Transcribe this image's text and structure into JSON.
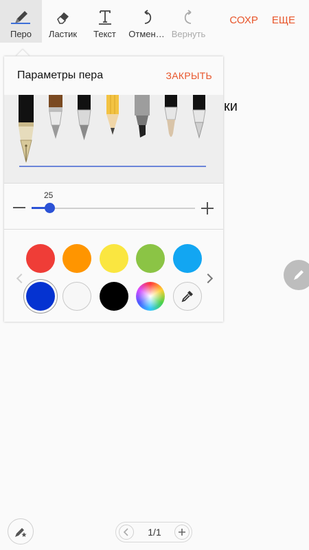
{
  "toolbar": {
    "tools": [
      {
        "label": "Перо",
        "icon": "pen-icon"
      },
      {
        "label": "Ластик",
        "icon": "eraser-icon"
      },
      {
        "label": "Текст",
        "icon": "text-icon"
      },
      {
        "label": "Отмен…",
        "icon": "undo-icon"
      },
      {
        "label": "Вернуть",
        "icon": "redo-icon"
      }
    ],
    "save_label": "СОХР",
    "more_label": "ЕЩЕ"
  },
  "pen_settings": {
    "title": "Параметры пера",
    "close_label": "ЗАКРЫТЬ",
    "size_value": "25",
    "size_fraction": 0.1,
    "colors": [
      "#ef3d37",
      "#ff9500",
      "#fae640",
      "#8bc445",
      "#12a6f2",
      "#0533d1",
      "#f7f7f7",
      "#000000",
      "rainbow",
      "eyedropper"
    ],
    "selected_color": "#0533d1",
    "pen_line_color": "#6b85d9"
  },
  "background_text": "ки",
  "pager": {
    "count": "1/1"
  },
  "accent_color": "#e8552a"
}
